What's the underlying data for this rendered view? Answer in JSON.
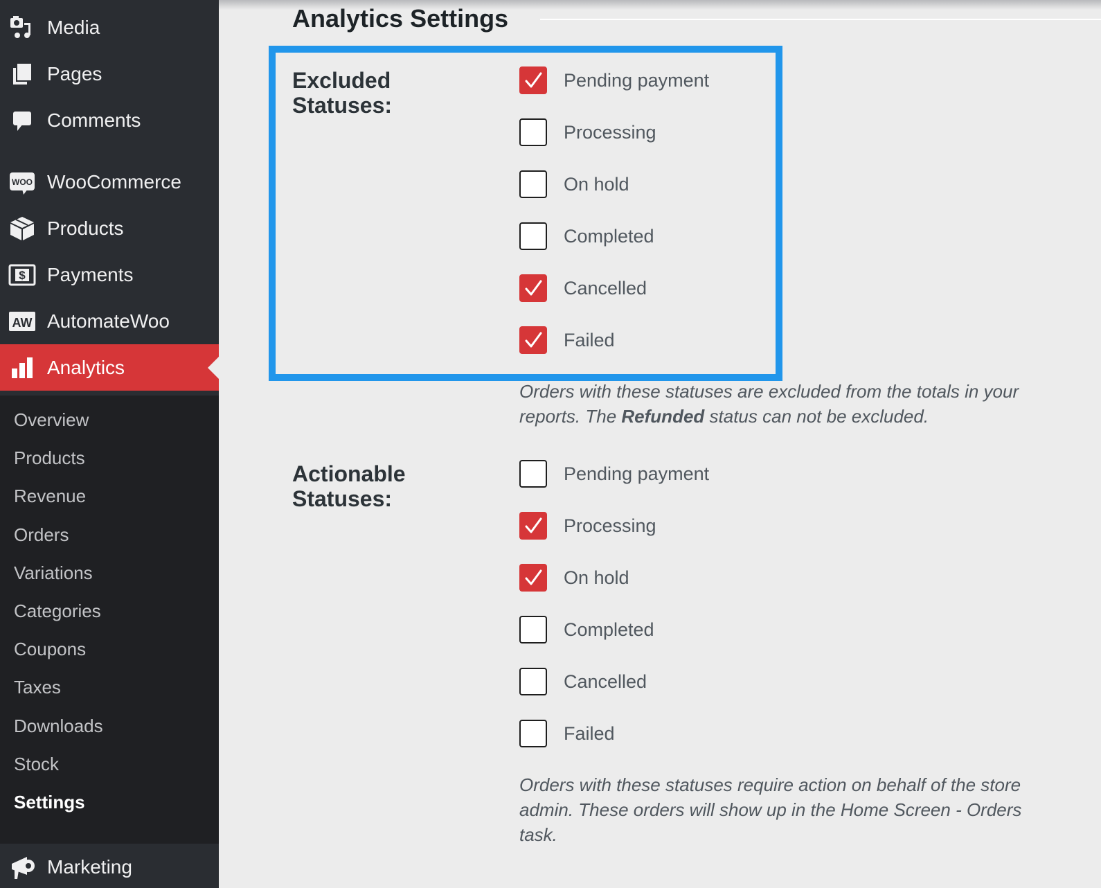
{
  "sidebar": {
    "items": [
      {
        "label": "Media",
        "icon": "media-icon"
      },
      {
        "label": "Pages",
        "icon": "pages-icon"
      },
      {
        "label": "Comments",
        "icon": "comments-icon"
      },
      {
        "label": "WooCommerce",
        "icon": "woocommerce-icon"
      },
      {
        "label": "Products",
        "icon": "products-box-icon"
      },
      {
        "label": "Payments",
        "icon": "payments-dollar-icon"
      },
      {
        "label": "AutomateWoo",
        "icon": "automatewoo-icon"
      },
      {
        "label": "Analytics",
        "icon": "analytics-bar-chart-icon",
        "active": true
      },
      {
        "label": "Marketing",
        "icon": "marketing-megaphone-icon"
      }
    ],
    "woo_icon_text": "WOO",
    "aw_icon_text": "AW",
    "payments_icon_text": "$",
    "submenu": [
      {
        "label": "Overview"
      },
      {
        "label": "Products"
      },
      {
        "label": "Revenue"
      },
      {
        "label": "Orders"
      },
      {
        "label": "Variations"
      },
      {
        "label": "Categories"
      },
      {
        "label": "Coupons"
      },
      {
        "label": "Taxes"
      },
      {
        "label": "Downloads"
      },
      {
        "label": "Stock"
      },
      {
        "label": "Settings",
        "current": true
      }
    ]
  },
  "page": {
    "title": "Analytics Settings"
  },
  "colors": {
    "accent_red": "#d63638",
    "highlight_blue": "#2196eb",
    "sidebar_bg": "#2a2d32",
    "submenu_bg": "#1f2023"
  },
  "excluded": {
    "label_line1": "Excluded",
    "label_line2": "Statuses:",
    "options": [
      {
        "label": "Pending payment",
        "checked": true
      },
      {
        "label": "Processing",
        "checked": false
      },
      {
        "label": "On hold",
        "checked": false
      },
      {
        "label": "Completed",
        "checked": false
      },
      {
        "label": "Cancelled",
        "checked": true
      },
      {
        "label": "Failed",
        "checked": true
      }
    ],
    "help_before": "Orders with these statuses are excluded from the totals in your reports. The ",
    "help_bold": "Refunded",
    "help_after": " status can not be excluded."
  },
  "actionable": {
    "label_line1": "Actionable",
    "label_line2": "Statuses:",
    "options": [
      {
        "label": "Pending payment",
        "checked": false
      },
      {
        "label": "Processing",
        "checked": true
      },
      {
        "label": "On hold",
        "checked": true
      },
      {
        "label": "Completed",
        "checked": false
      },
      {
        "label": "Cancelled",
        "checked": false
      },
      {
        "label": "Failed",
        "checked": false
      }
    ],
    "help": "Orders with these statuses require action on behalf of the store admin. These orders will show up in the Home Screen - Orders task."
  }
}
